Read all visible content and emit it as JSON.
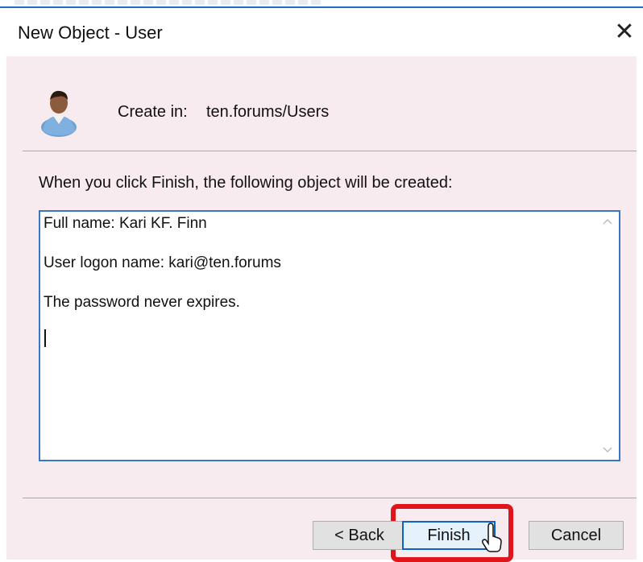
{
  "window": {
    "title": "New Object - User",
    "close_glyph": "✕"
  },
  "header": {
    "icon": "user-icon",
    "create_in_label": "Create in:",
    "create_in_value": "ten.forums/Users"
  },
  "main": {
    "intro": "When you click Finish, the following object will be created:",
    "summary_lines": [
      "Full name: Kari KF. Finn",
      "User logon name: kari@ten.forums",
      "The password never expires."
    ]
  },
  "buttons": {
    "back": "< Back",
    "finish": "Finish",
    "cancel": "Cancel"
  },
  "colors": {
    "dialog_background": "#f7ebef",
    "textbox_border": "#3b76c4",
    "highlight": "#e0141b",
    "default_button_border": "#0a64c8"
  }
}
